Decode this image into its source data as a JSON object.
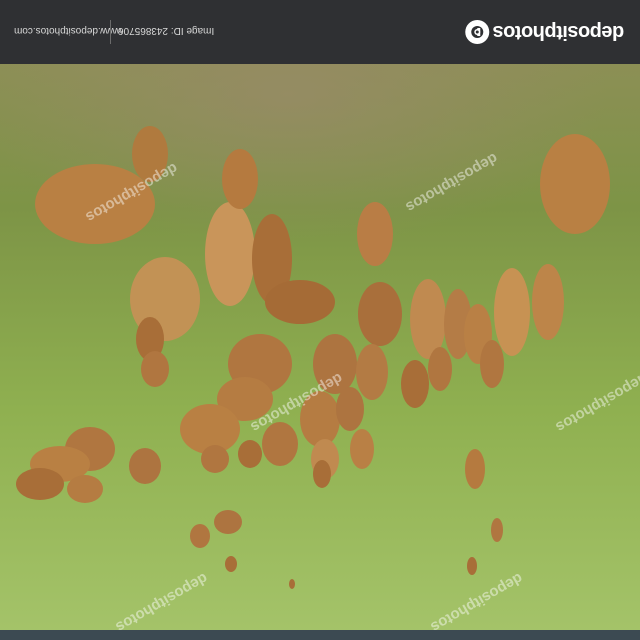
{
  "header": {
    "brand_name": "depositphotos",
    "image_id_label": "Image ID: 243865706",
    "site_url": "www.depositphotos.com"
  },
  "photo": {
    "description_icon": "cattle-herd-photo",
    "watermark_text": "depositphotos",
    "colors": {
      "grass": "#86a34a",
      "cattle": "#c08a4a",
      "header": "#2f3033"
    }
  }
}
